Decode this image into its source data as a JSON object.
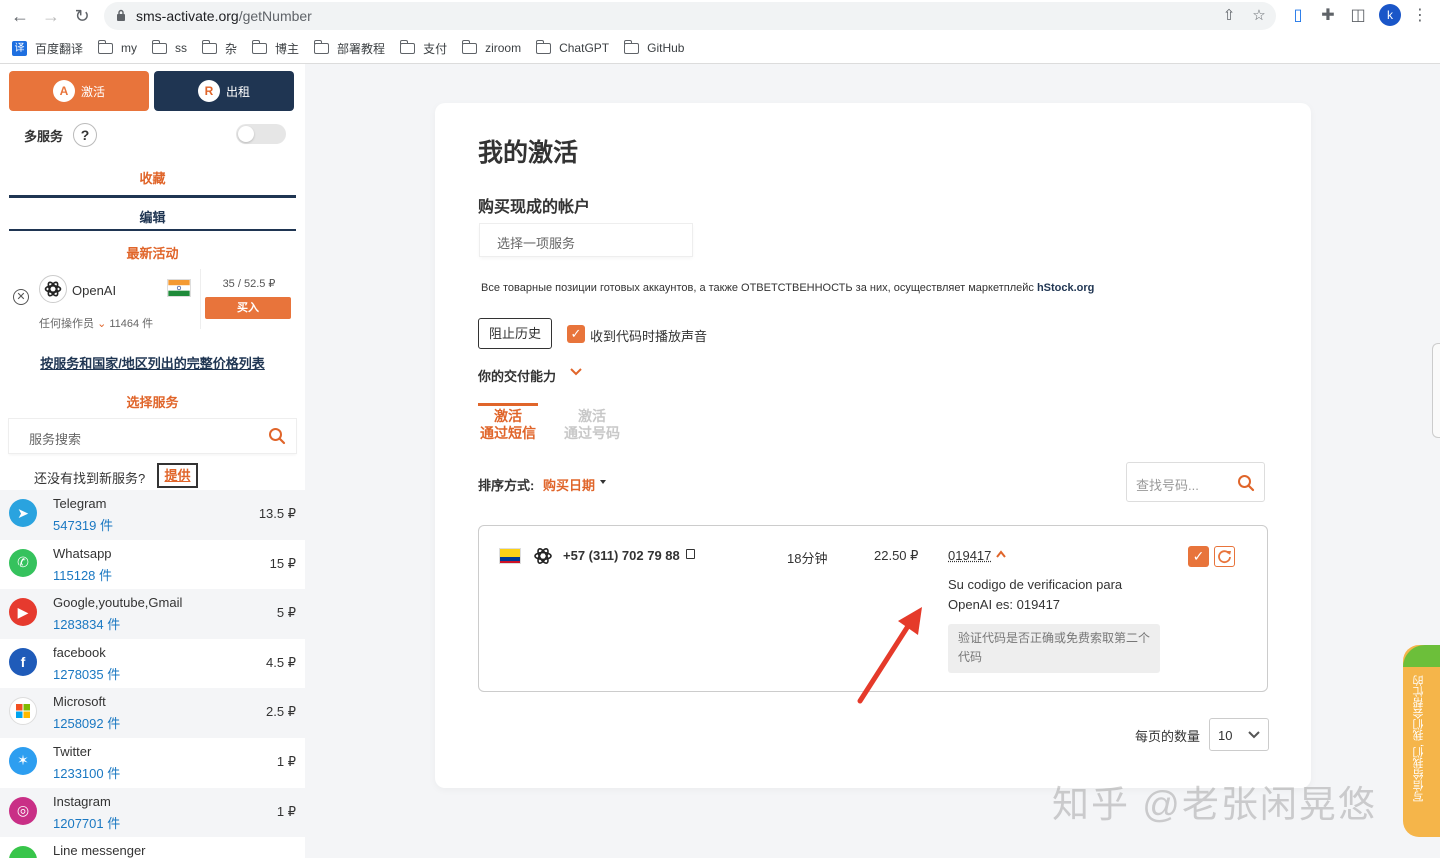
{
  "browser": {
    "url_host": "sms-activate.org",
    "url_path": "/getNumber",
    "profile_initial": "k",
    "bookmarks": [
      {
        "label": "百度翻译",
        "type": "translate",
        "icon_text": "译"
      },
      {
        "label": "my",
        "type": "folder"
      },
      {
        "label": "ss",
        "type": "folder"
      },
      {
        "label": "杂",
        "type": "folder"
      },
      {
        "label": "博主",
        "type": "folder"
      },
      {
        "label": "部署教程",
        "type": "folder"
      },
      {
        "label": "支付",
        "type": "folder"
      },
      {
        "label": "ziroom",
        "type": "folder"
      },
      {
        "label": "ChatGPT",
        "type": "folder"
      },
      {
        "label": "GitHub",
        "type": "folder"
      }
    ]
  },
  "sidebar": {
    "activate_label": "激活",
    "rent_label": "出租",
    "multi_service_label": "多服务",
    "help_glyph": "?",
    "favorites_label": "收藏",
    "edit_label": "编辑",
    "latest_label": "最新活动",
    "favorite": {
      "name": "OpenAI",
      "price": "35 / 52.5 ₽",
      "buy_label": "买入",
      "operator_label": "任何操作员",
      "count": "11464 件"
    },
    "full_price_list_label": "按服务和国家/地区列出的完整价格列表",
    "select_service_label": "选择服务",
    "search_placeholder": "服务搜索",
    "not_found_label": "还没有找到新服务?",
    "offer_label": "提供",
    "services": [
      {
        "name": "Telegram",
        "count": "547319 件",
        "price": "13.5 ₽",
        "icon": "telegram-icon",
        "color": "#2aa3df"
      },
      {
        "name": "Whatsapp",
        "count": "115128 件",
        "price": "15 ₽",
        "icon": "whatsapp-icon",
        "color": "#35c25d"
      },
      {
        "name": "Google,youtube,Gmail",
        "count": "1283834 件",
        "price": "5 ₽",
        "icon": "youtube-icon",
        "color": "#e63a2e"
      },
      {
        "name": "facebook",
        "count": "1278035 件",
        "price": "4.5 ₽",
        "icon": "facebook-icon",
        "color": "#1f5bb9"
      },
      {
        "name": "Microsoft",
        "count": "1258092 件",
        "price": "2.5 ₽",
        "icon": "microsoft-icon",
        "color": "#ffffff"
      },
      {
        "name": "Twitter",
        "count": "1233100 件",
        "price": "1 ₽",
        "icon": "twitter-icon",
        "color": "#2d9ef0"
      },
      {
        "name": "Instagram",
        "count": "1207701 件",
        "price": "1 ₽",
        "icon": "instagram-icon",
        "color": "#c92f86"
      },
      {
        "name": "Line messenger",
        "count": "",
        "price": "",
        "icon": "line-icon",
        "color": "#38c54a"
      }
    ]
  },
  "main": {
    "title": "我的激活",
    "subtitle": "购买现成的帐户",
    "service_select_placeholder": "选择一项服务",
    "notice_text": "Все товарные позиции готовых аккаунтов, а также ОТВЕТСТВЕННОСТЬ за них, осуществляет маркетплейс ",
    "notice_link": "hStock.org",
    "stop_history_label": "阻止历史",
    "sound_checkbox_label": "收到代码时播放声音",
    "sound_checked": true,
    "payment_label": "你的交付能力",
    "tab_sms_line1": "激活",
    "tab_sms_line2": "通过短信",
    "tab_number_line1": "激活",
    "tab_number_line2": "通过号码",
    "sort_label": "排序方式:",
    "sort_value": "购买日期",
    "number_search_placeholder": "查找号码...",
    "activation": {
      "phone": "+57 (311) 702 79 88",
      "duration": "18分钟",
      "cost": "22.50 ₽",
      "code": "019417",
      "message": "Su codigo de verificacion para OpenAI es: 019417",
      "hint": "验证代码是否正确或免费索取第二个代码"
    },
    "per_page_label": "每页的数量",
    "per_page_value": "10"
  },
  "overlay": {
    "watermark": "知乎 @老张闲晃悠",
    "side_tab_text": "写信给我们, 我们会帮忙的"
  },
  "colors": {
    "accent": "#e8743b",
    "navy": "#1f3552",
    "link_blue": "#1a78c2"
  }
}
